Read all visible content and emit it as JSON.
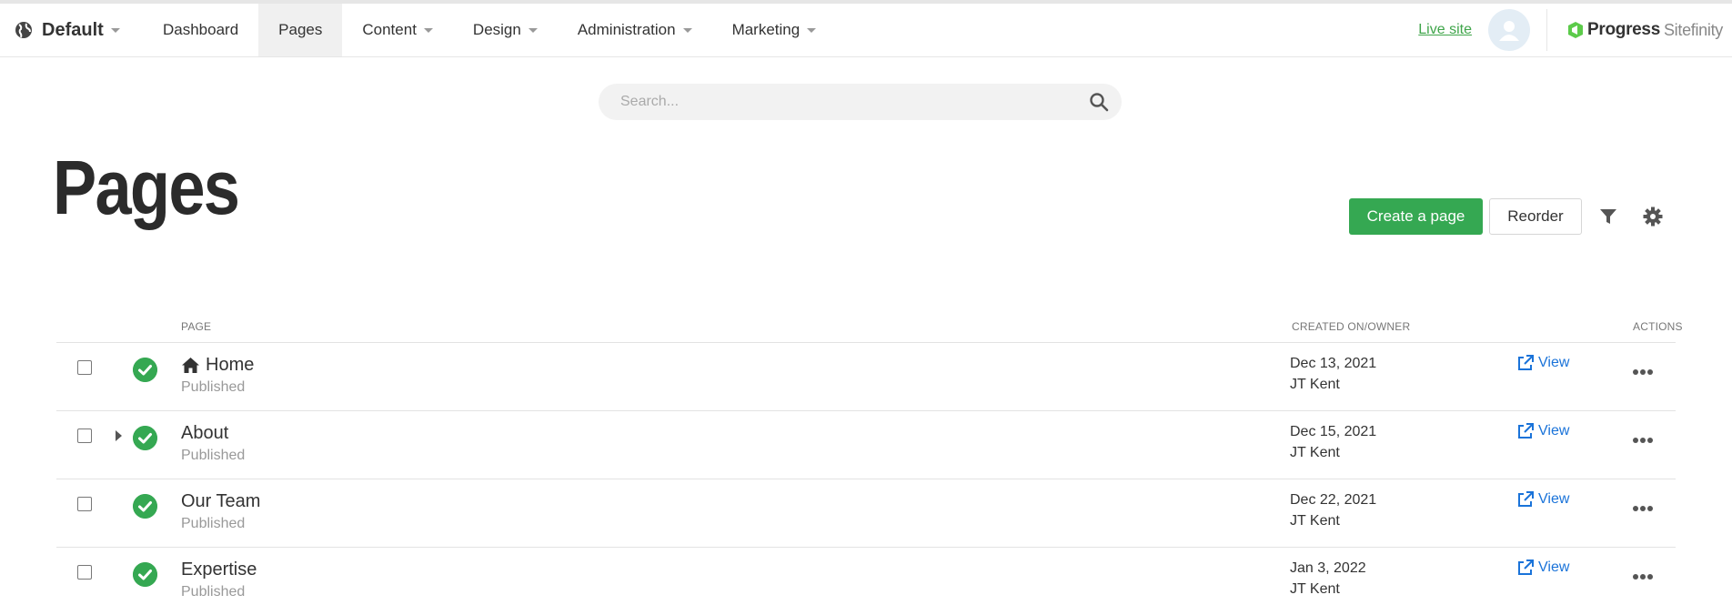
{
  "topbar": {
    "site_name": "Default",
    "nav": [
      "Dashboard",
      "Pages",
      "Content",
      "Design",
      "Administration",
      "Marketing"
    ],
    "live_site": "Live site",
    "brand_progress": "Progress",
    "brand_sitefinity": "Sitefinity"
  },
  "search": {
    "placeholder": "Search..."
  },
  "page_title": "Pages",
  "toolbar": {
    "create_label": "Create a page",
    "reorder_label": "Reorder"
  },
  "table": {
    "headers": {
      "page": "PAGE",
      "created": "CREATED ON/OWNER",
      "actions": "ACTIONS"
    },
    "rows": [
      {
        "title": "Home",
        "status": "Published",
        "created": "Dec 13, 2021",
        "owner": "JT Kent",
        "view": "View"
      },
      {
        "title": "About",
        "status": "Published",
        "created": "Dec 15, 2021",
        "owner": "JT Kent",
        "view": "View"
      },
      {
        "title": "Our Team",
        "status": "Published",
        "created": "Dec 22, 2021",
        "owner": "JT Kent",
        "view": "View"
      },
      {
        "title": "Expertise",
        "status": "Published",
        "created": "Jan 3, 2022",
        "owner": "JT Kent",
        "view": "View"
      }
    ]
  },
  "colors": {
    "accent_green": "#35a852",
    "link_blue": "#1a73d9",
    "live_site_green": "#3fa54a"
  },
  "icons": [
    "globe-icon",
    "avatar-icon",
    "brand-logo-icon",
    "search-icon",
    "filter-icon",
    "gear-icon",
    "home-icon",
    "status-published-icon",
    "external-link-icon",
    "more-icon",
    "expand-arrow-icon"
  ]
}
